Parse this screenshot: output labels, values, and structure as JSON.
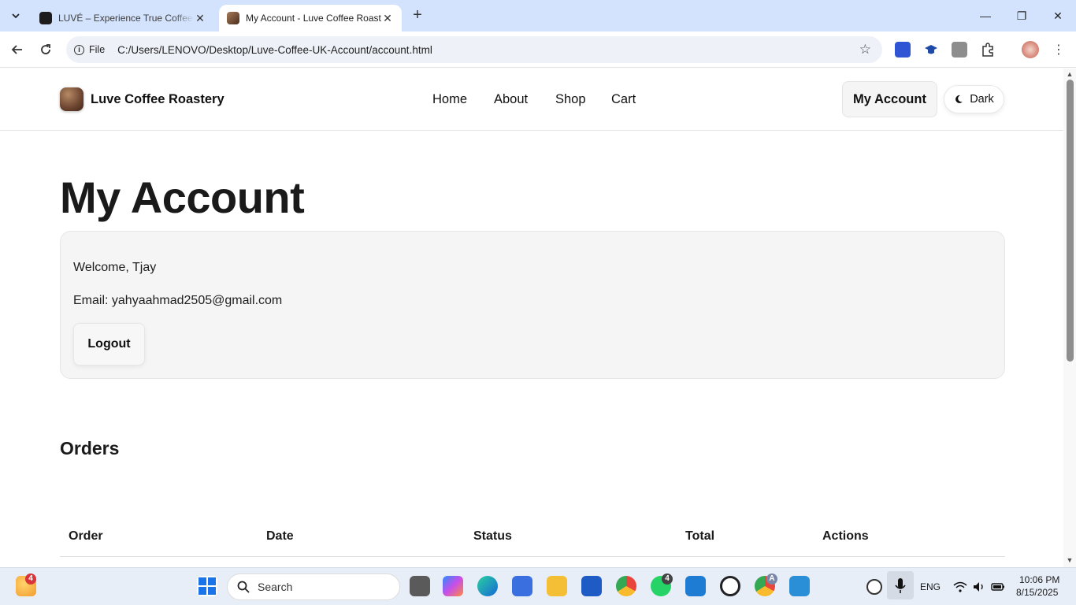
{
  "browser": {
    "tabs": [
      {
        "title": "LUVÉ – Experience True Coffee"
      },
      {
        "title": "My Account - Luve Coffee Roastery"
      }
    ],
    "address": {
      "chip": "File",
      "url": "C:/Users/LENOVO/Desktop/Luve-Coffee-UK-Account/account.html"
    }
  },
  "site": {
    "brand": "Luve Coffee Roastery",
    "nav": [
      "Home",
      "About",
      "Shop",
      "Cart"
    ],
    "account_button": "My Account",
    "theme_toggle": "Dark"
  },
  "main": {
    "title": "My Account",
    "welcome": "Welcome, Tjay",
    "email": "Email: yahyaahmad2505@gmail.com",
    "logout": "Logout",
    "orders_title": "Orders",
    "orders_columns": [
      "Order",
      "Date",
      "Status",
      "Total",
      "Actions"
    ]
  },
  "taskbar": {
    "search_placeholder": "Search",
    "weather_badge": "4",
    "whatsapp_badge": "4",
    "chrome_badge": "A",
    "language": "ENG",
    "time": "10:06 PM",
    "date": "8/15/2025"
  }
}
